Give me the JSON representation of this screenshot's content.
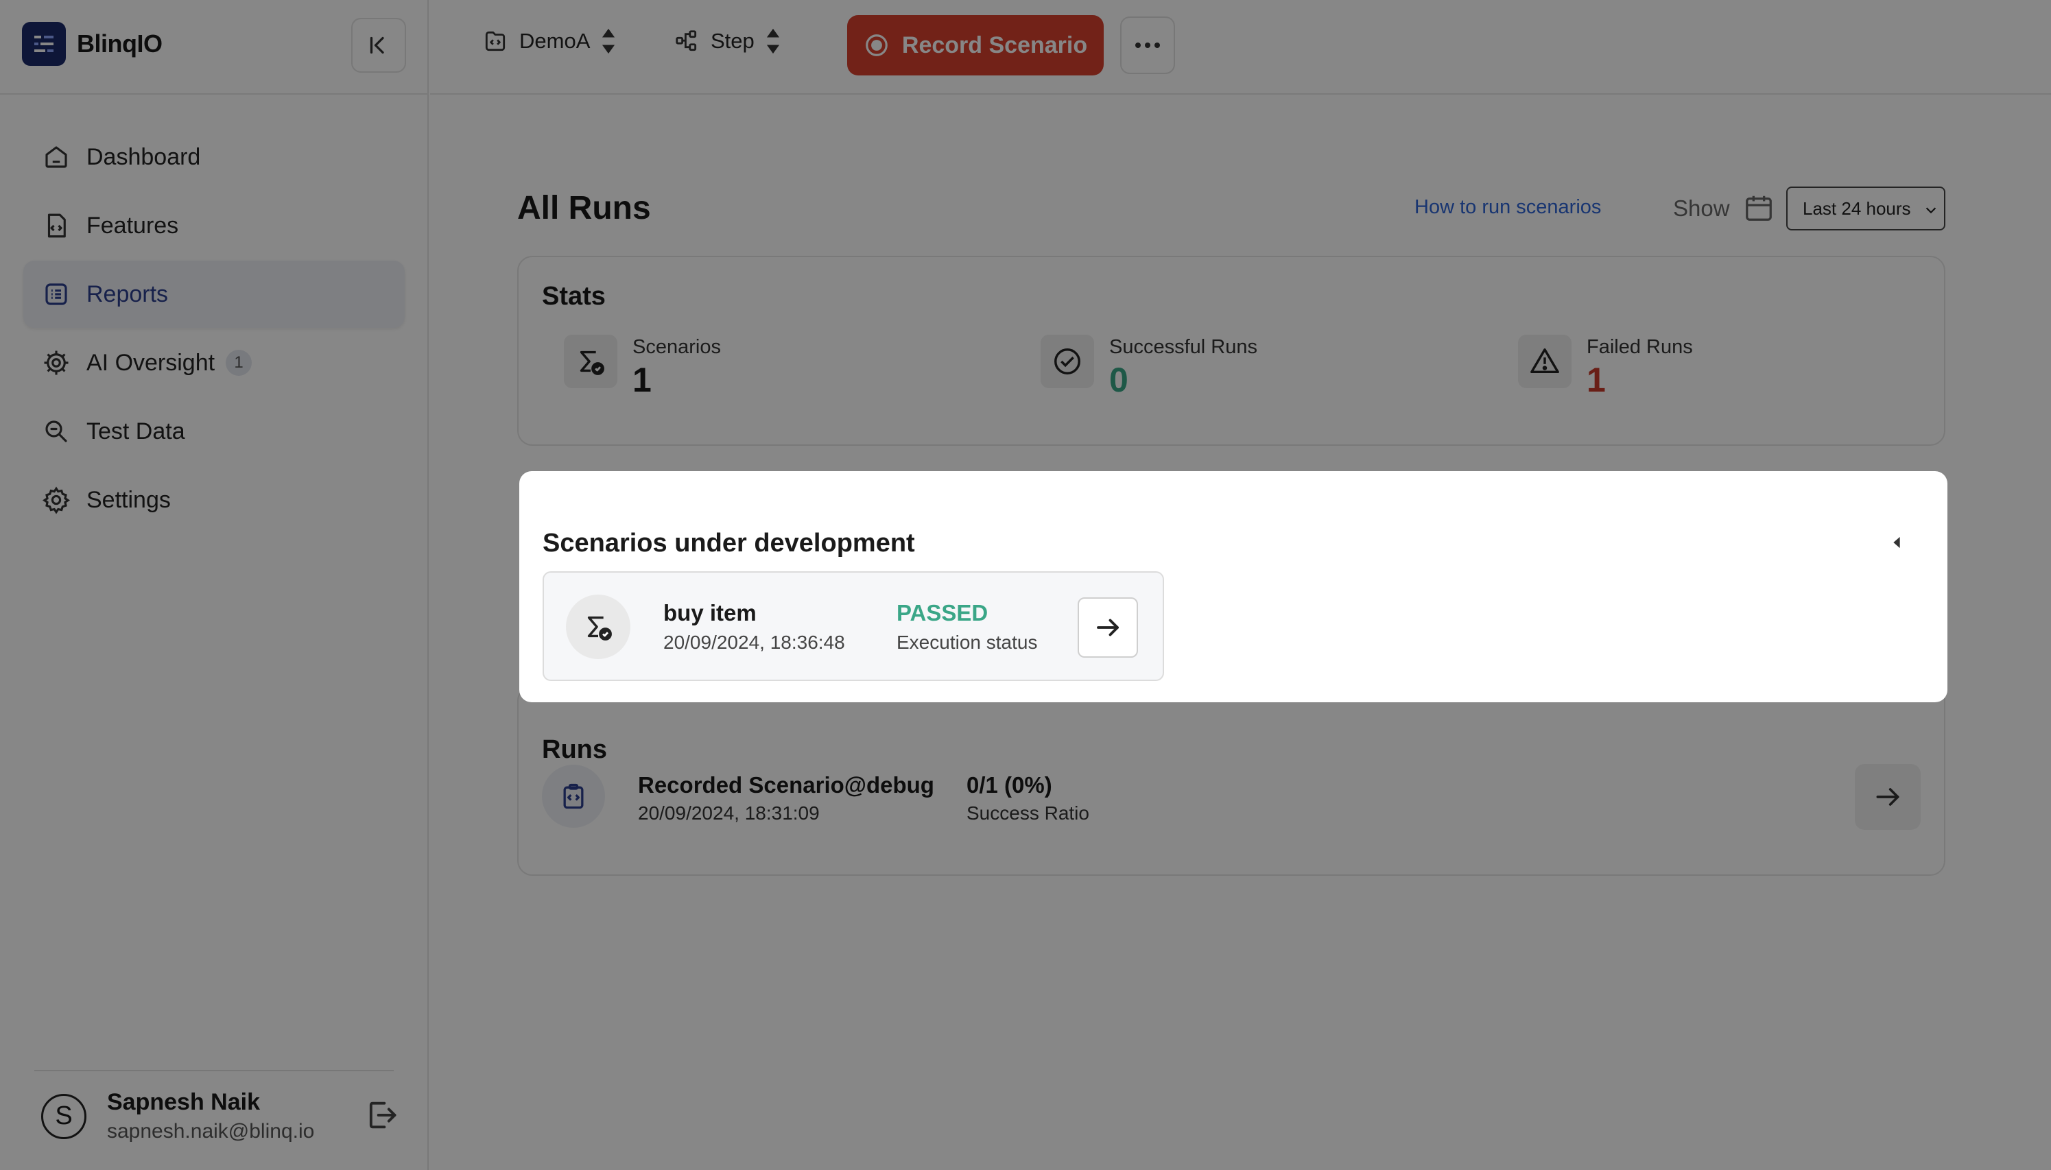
{
  "brand": {
    "name": "BlinqIO",
    "logo_icon": "blinqio-logo-icon",
    "color": "#1c2a6b"
  },
  "sidebar": {
    "items": [
      {
        "label": "Dashboard",
        "icon": "home-icon"
      },
      {
        "label": "Features",
        "icon": "feature-file-icon"
      },
      {
        "label": "Reports",
        "icon": "list-icon",
        "active": true
      },
      {
        "label": "AI Oversight",
        "icon": "gear-cog-icon",
        "badge": "1"
      },
      {
        "label": "Test Data",
        "icon": "search-data-icon"
      },
      {
        "label": "Settings",
        "icon": "settings-icon"
      }
    ],
    "user": {
      "initial": "S",
      "name": "Sapnesh Naik",
      "email": "sapnesh.naik@blinq.io"
    }
  },
  "topbar": {
    "project": "DemoA",
    "mode": "Step",
    "record_label": "Record Scenario",
    "record_color": "#d7412e"
  },
  "main": {
    "title": "All Runs",
    "howto_link": "How to run scenarios",
    "show_label": "Show",
    "range_value": "Last 24 hours",
    "stats": {
      "title": "Stats",
      "items": [
        {
          "label": "Scenarios",
          "value": "1",
          "color": "#1a1a1a"
        },
        {
          "label": "Successful Runs",
          "value": "0",
          "color": "#3aa687"
        },
        {
          "label": "Failed Runs",
          "value": "1",
          "color": "#c7392a"
        }
      ]
    },
    "under_dev": {
      "title": "Scenarios under development",
      "scenario": {
        "name": "buy item",
        "date": "20/09/2024, 18:36:48",
        "status": "PASSED",
        "status_label": "Execution status",
        "status_color": "#3aa687"
      }
    },
    "runs": {
      "title": "Runs",
      "items": [
        {
          "name": "Recorded Scenario@debug",
          "date": "20/09/2024, 18:31:09",
          "ratio": "0/1 (0%)",
          "ratio_label": "Success Ratio"
        }
      ]
    }
  }
}
